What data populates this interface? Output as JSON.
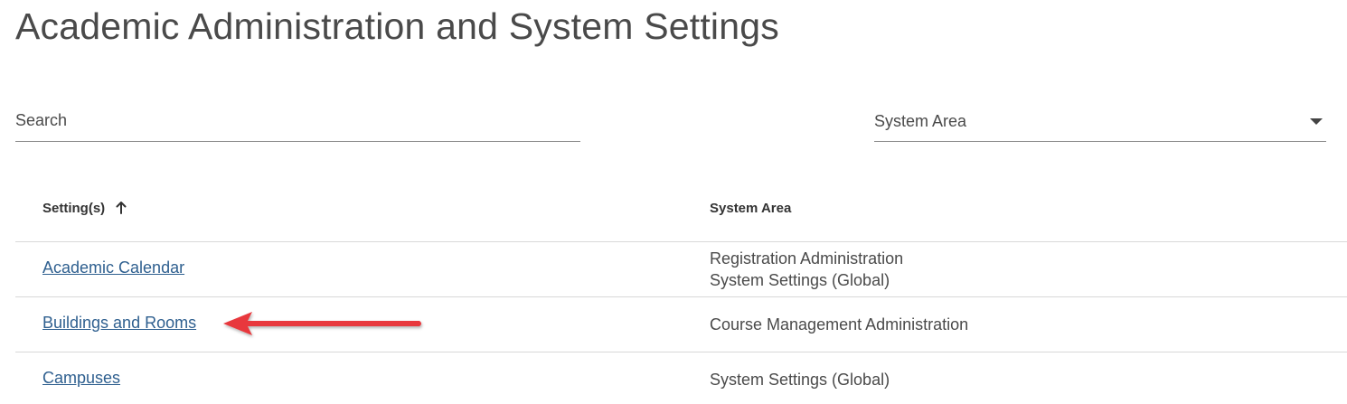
{
  "page": {
    "title": "Academic Administration and System Settings"
  },
  "filters": {
    "search_placeholder": "Search",
    "system_area_value": "System Area"
  },
  "table": {
    "headers": {
      "setting": "Setting(s)",
      "system_area": "System Area"
    },
    "rows": [
      {
        "setting": "Academic Calendar",
        "areas": [
          "Registration Administration",
          "System Settings (Global)"
        ]
      },
      {
        "setting": "Buildings and Rooms",
        "areas": [
          "Course Management Administration"
        ]
      },
      {
        "setting": "Campuses",
        "areas": [
          "System Settings (Global)"
        ]
      }
    ]
  },
  "colors": {
    "link": "#2e5f8f",
    "annotation_arrow": "#e8383d"
  },
  "icons": {
    "sort": "arrow-up-icon",
    "dropdown": "caret-down-icon",
    "annotation": "red-arrow-icon"
  }
}
